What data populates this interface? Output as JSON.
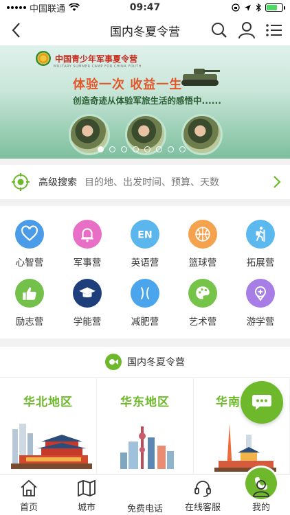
{
  "status_bar": {
    "carrier": "中国联通",
    "time": "09:47",
    "battery_level": 0.7
  },
  "header": {
    "title": "国内冬夏令营"
  },
  "banner": {
    "logo_text": "中国青少年军事夏令营",
    "logo_subtext": "MILITARY SUMMER CAMP FOR CHINA YOUTH",
    "slogan": "体验一次 收益一生",
    "tagline": "创造奇迹从体验军旅生活的感悟中......",
    "dot_count": 8,
    "active_dot": 0
  },
  "search": {
    "label": "高级搜索",
    "hint": "目的地、出发时间、预算、天数"
  },
  "categories": [
    {
      "label": "心智营",
      "icon": "heart-icon",
      "color": "#4a9ce8"
    },
    {
      "label": "军事营",
      "icon": "bell-icon",
      "color": "#e96fc6"
    },
    {
      "label": "英语营",
      "icon": "en-icon",
      "color": "#5ab6ec"
    },
    {
      "label": "篮球营",
      "icon": "basketball-icon",
      "color": "#f4a24d"
    },
    {
      "label": "拓展营",
      "icon": "hiker-icon",
      "color": "#5cb9f0"
    },
    {
      "label": "励志营",
      "icon": "thumbs-up-icon",
      "color": "#73c14b"
    },
    {
      "label": "学能营",
      "icon": "graduation-cap-icon",
      "color": "#1f3f7c"
    },
    {
      "label": "减肥营",
      "icon": "waist-icon",
      "color": "#4aa5ec"
    },
    {
      "label": "艺术营",
      "icon": "palette-icon",
      "color": "#76c34a"
    },
    {
      "label": "游学营",
      "icon": "location-icon",
      "color": "#a77ee6"
    }
  ],
  "section": {
    "title": "国内冬夏令营",
    "regions": [
      {
        "name": "华北地区"
      },
      {
        "name": "华东地区"
      },
      {
        "name": "华南"
      }
    ]
  },
  "tabbar": {
    "items": [
      {
        "label": "首页",
        "icon": "home-icon"
      },
      {
        "label": "城市",
        "icon": "map-icon"
      },
      {
        "label": "免费电话",
        "icon": "phone-icon"
      },
      {
        "label": "在线客服",
        "icon": "headset-icon"
      },
      {
        "label": "我的",
        "icon": "user-icon"
      }
    ]
  },
  "colors": {
    "accent": "#6eb92b"
  }
}
